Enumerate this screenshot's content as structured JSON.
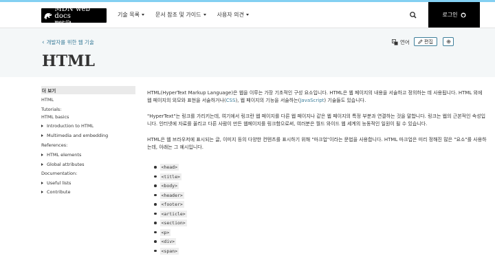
{
  "header": {
    "logo_line1": "MDN web docs",
    "logo_line2": "moz://a",
    "nav": [
      "기술 목록",
      "문서 참조 및 가이드",
      "사용자 의견"
    ],
    "login_label": "로그인"
  },
  "hero": {
    "breadcrumb": "개발자를 위한 웹 기술",
    "title": "HTML",
    "language_label": "언어",
    "edit_label": "편집"
  },
  "sidebar": {
    "more_label": "더 보기",
    "html_link": "HTML",
    "tutorials_head": "Tutorials:",
    "html_basics": "HTML basics",
    "intro": "Introduction to HTML",
    "multimedia": "Multimedia and embedding",
    "references_head": "References:",
    "elements": "HTML elements",
    "global_attrs": "Global attributes",
    "documentation_head": "Documentation:",
    "useful_lists": "Useful lists",
    "contribute": "Contribute"
  },
  "content": {
    "p1_a": "HTML(HyperText Markup Language)은 웹을 이루는 가장 기초적인 구성 요소입니다. HTML은 웹 페이지의 내용을 서술하고 정의하는 데 사용됩니다. HTML 외에 웹 페이지의 외모와 표현을 서술하거나(",
    "p1_css": "CSS",
    "p1_b": "), 웹 페이지의 기능을 서술하는(",
    "p1_js": "JavaScript",
    "p1_c": ") 기술들도 있습니다.",
    "p2": "\"HyperText\"는 링크를 가리키는데, 여기에서 링크란 웹 페이지를 다른 웹 페이지나 같은 웹 페이지의 특정 부분과 연결하는 것을 말합니다. 링크는 웹의 근본적인 속성입니다. 인터넷에 자료를 올리고 다른 사람이 만든 웹페이지를 링크함으로써, 여러분은 월드 와이드 웹 세계의 능동적인 일원이 될 수 있습니다.",
    "p3": "HTML은 웹 브라우저에 표시되는 글, 이미지 등의 다양한 컨텐츠를 표시하기 위해 \"마크업\"이라는 문법을 사용합니다. HTML 마크업은 미리 정해진 많은 \"요소\"를 사용하는데, 아래는 그 예시입니다.",
    "tags": [
      "<head>",
      "<title>",
      "<body>",
      "<header>",
      "<footer>",
      "<article>",
      "<section>",
      "<p>",
      "<div>",
      "<span>"
    ]
  }
}
